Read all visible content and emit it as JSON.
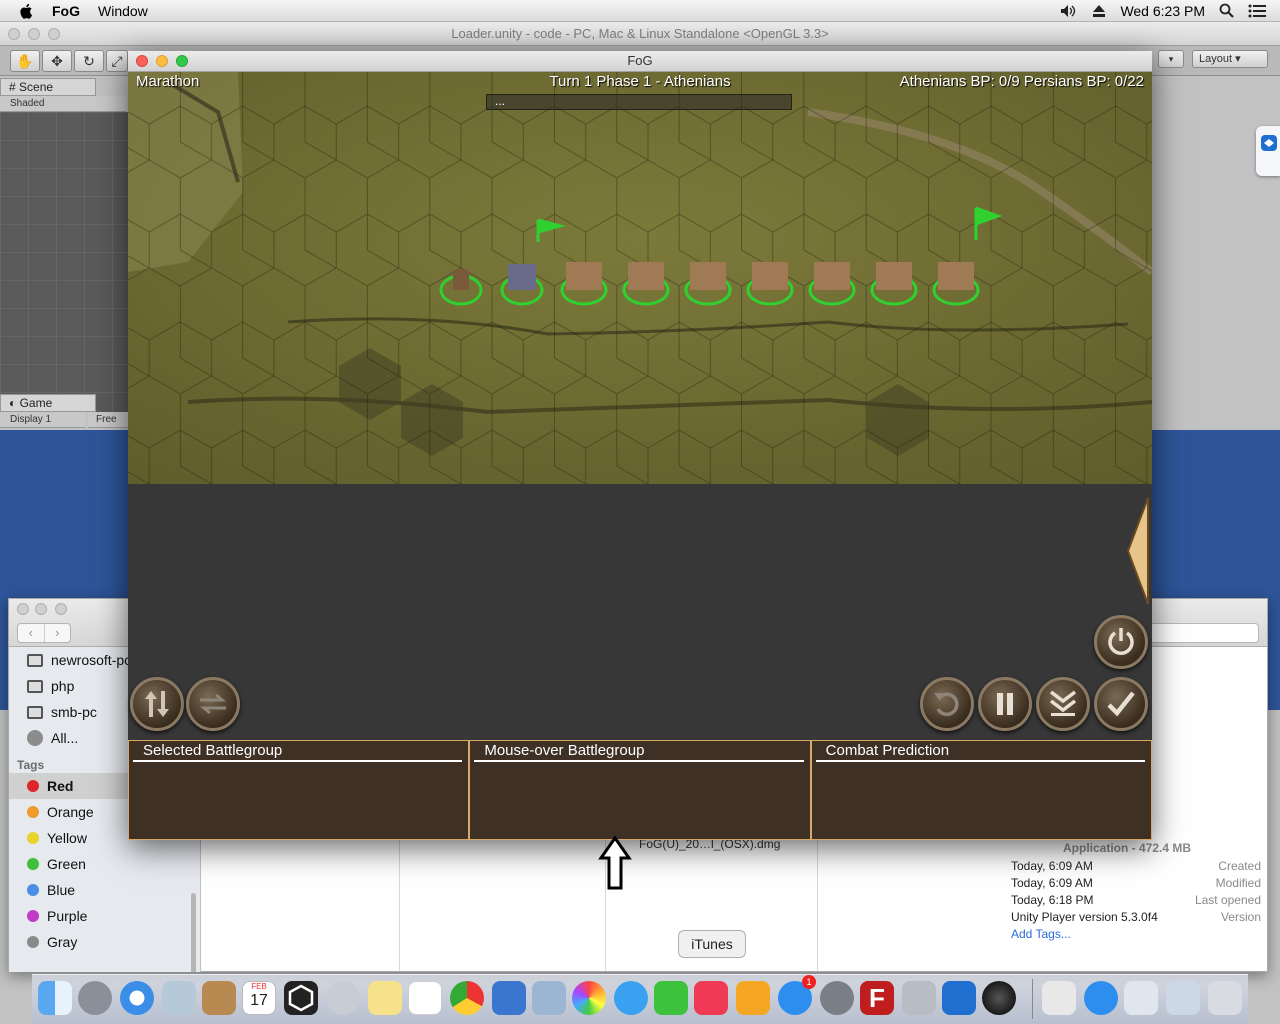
{
  "menubar": {
    "app": "FoG",
    "menus": [
      "Window"
    ],
    "clock": "Wed 6:23 PM"
  },
  "unity": {
    "title": "Loader.unity - code - PC, Mac & Linux Standalone <OpenGL 3.3>",
    "layout_label": "Layout",
    "scene_tab": "Scene",
    "scene_mode": "Shaded",
    "game_tab": "Game",
    "display_label": "Display 1",
    "free_aspect_label": "Free As"
  },
  "finder": {
    "sidebar_devices": [
      "newrosoft-pc",
      "php",
      "smb-pc",
      "All..."
    ],
    "tags_heading": "Tags",
    "tags": [
      {
        "label": "Red",
        "color": "#e0242b"
      },
      {
        "label": "Orange",
        "color": "#f19a2c"
      },
      {
        "label": "Yellow",
        "color": "#e9d42b"
      },
      {
        "label": "Green",
        "color": "#3fc03a"
      },
      {
        "label": "Blue",
        "color": "#4a8ee6"
      },
      {
        "label": "Purple",
        "color": "#c13bc9"
      },
      {
        "label": "Gray",
        "color": "#8a8a8a"
      }
    ],
    "file_name": "FoG(U)_20…l_(OSX).dmg",
    "info": {
      "kind": "Application - 472.4 MB",
      "created_label": "Created",
      "created": "Today, 6:09 AM",
      "modified_label": "Modified",
      "modified": "Today, 6:09 AM",
      "last_opened_label": "Last opened",
      "last_opened": "Today, 6:18 PM",
      "version_label": "Version",
      "version": "Unity Player version 5.3.0f4",
      "add_tags": "Add Tags..."
    }
  },
  "game": {
    "window_title": "FoG",
    "scenario": "Marathon",
    "turn_info": "Turn 1 Phase 1 - Athenians",
    "score": "Athenians BP: 0/9  Persians BP: 0/22",
    "message": "...",
    "panels": [
      "Selected Battlegroup",
      "Mouse-over Battlegroup",
      "Combat Prediction"
    ]
  },
  "dock": {
    "tooltip": "iTunes",
    "calendar_month": "FEB",
    "calendar_day": "17",
    "appstore_badge": "1"
  }
}
